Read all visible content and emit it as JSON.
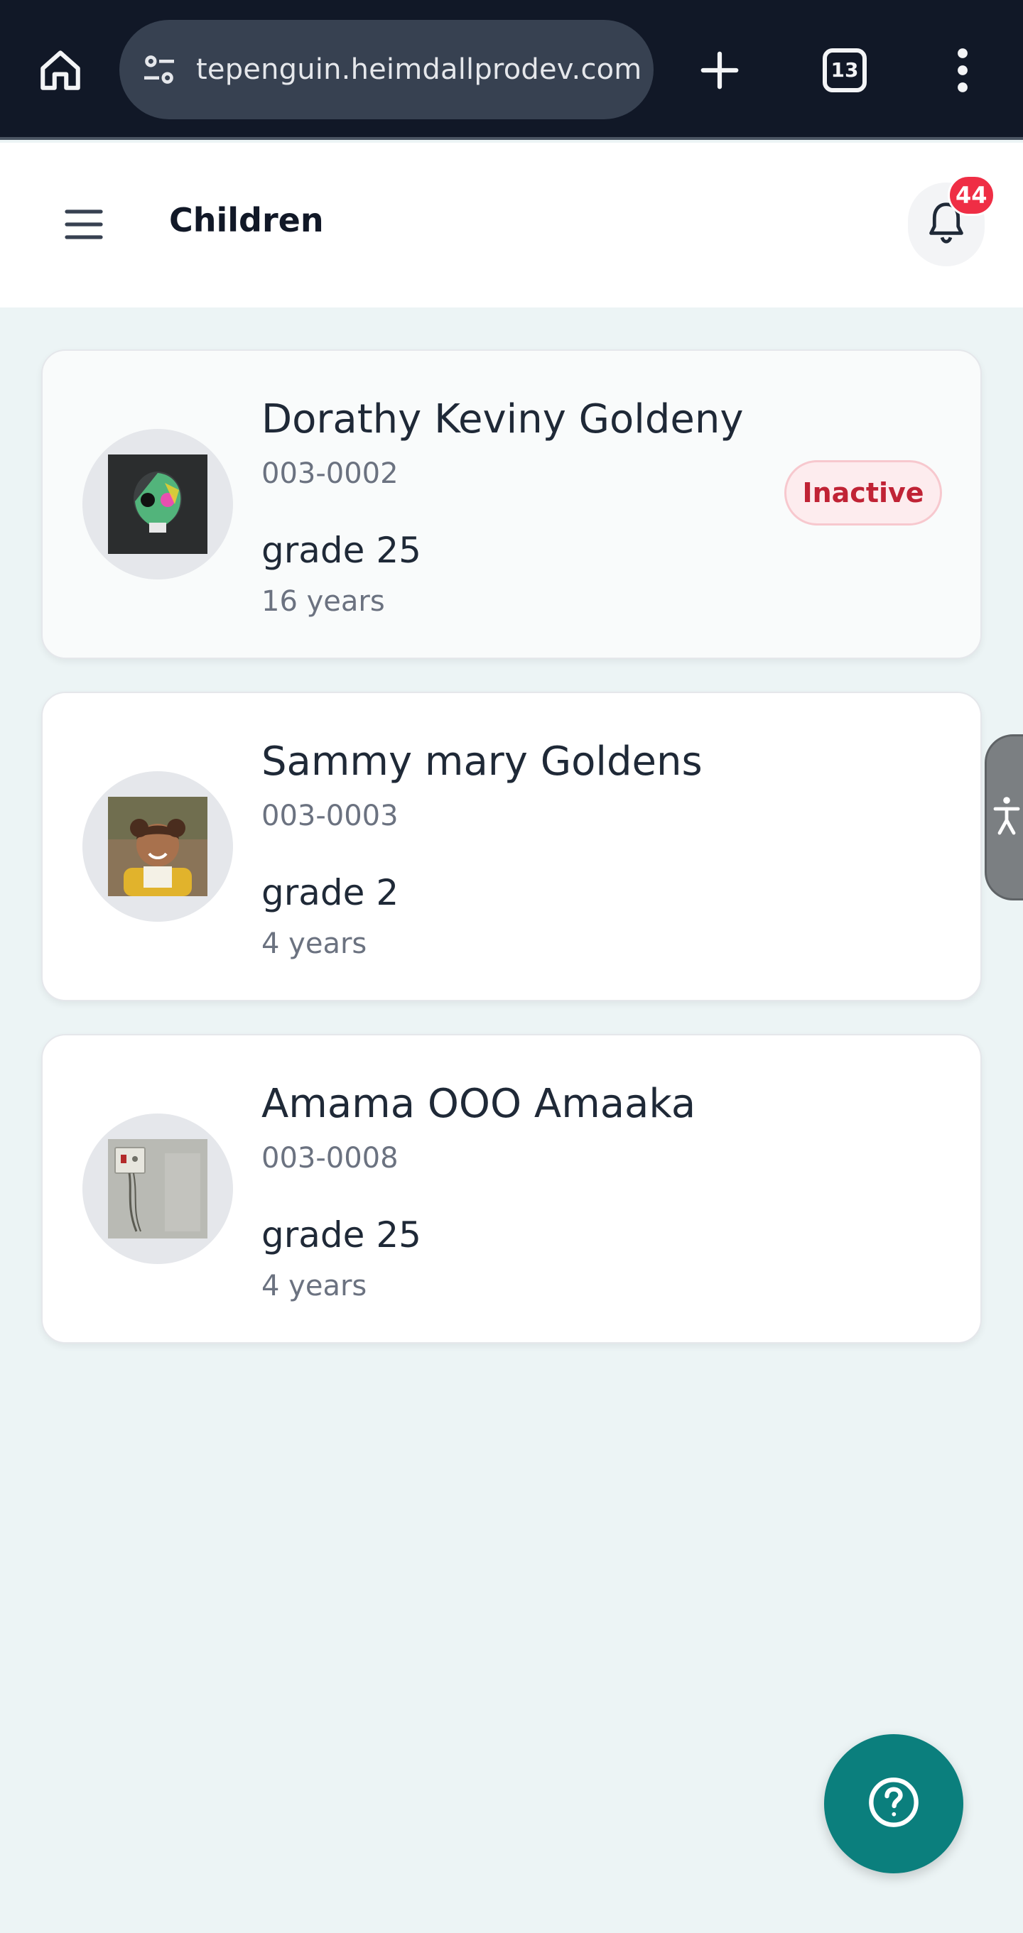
{
  "browser": {
    "url": "tepenguin.heimdallprodev.com",
    "tab_count": "13"
  },
  "header": {
    "title": "Children",
    "notification_count": "44"
  },
  "children": [
    {
      "name": "Dorathy Keviny Goldeny",
      "id": "003-0002",
      "grade": "grade 25",
      "age": "16 years",
      "status": "Inactive"
    },
    {
      "name": "Sammy mary Goldens",
      "id": "003-0003",
      "grade": "grade 2",
      "age": "4 years"
    },
    {
      "name": "Amama OOO Amaaka",
      "id": "003-0008",
      "grade": "grade 25",
      "age": "4 years"
    }
  ],
  "colors": {
    "accent": "#0b7f7d",
    "badge_red": "#ef2e45",
    "inactive_text": "#c02335"
  }
}
